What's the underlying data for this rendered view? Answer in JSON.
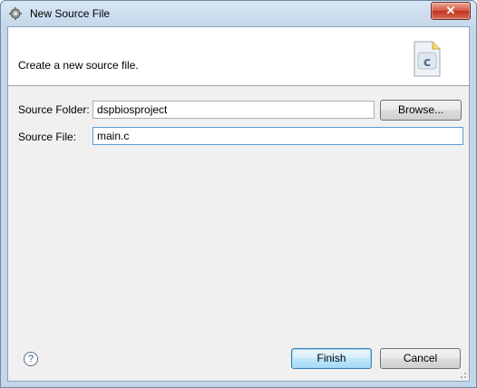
{
  "window": {
    "title": "New Source File",
    "close_label": "✕"
  },
  "banner": {
    "description": "Create a new source file.",
    "icon_letter": "c"
  },
  "form": {
    "source_folder_label": "Source Folder:",
    "source_folder_value": "dspbiosproject",
    "browse_label": "Browse...",
    "source_file_label": "Source File:",
    "source_file_value": "main.c"
  },
  "footer": {
    "help_label": "?",
    "finish_label": "Finish",
    "cancel_label": "Cancel"
  },
  "colors": {
    "titlebar": "#c4d6ea",
    "close_button": "#c1321c",
    "dialog_background": "#f0f0f0",
    "default_button_border": "#3c7fb1"
  }
}
